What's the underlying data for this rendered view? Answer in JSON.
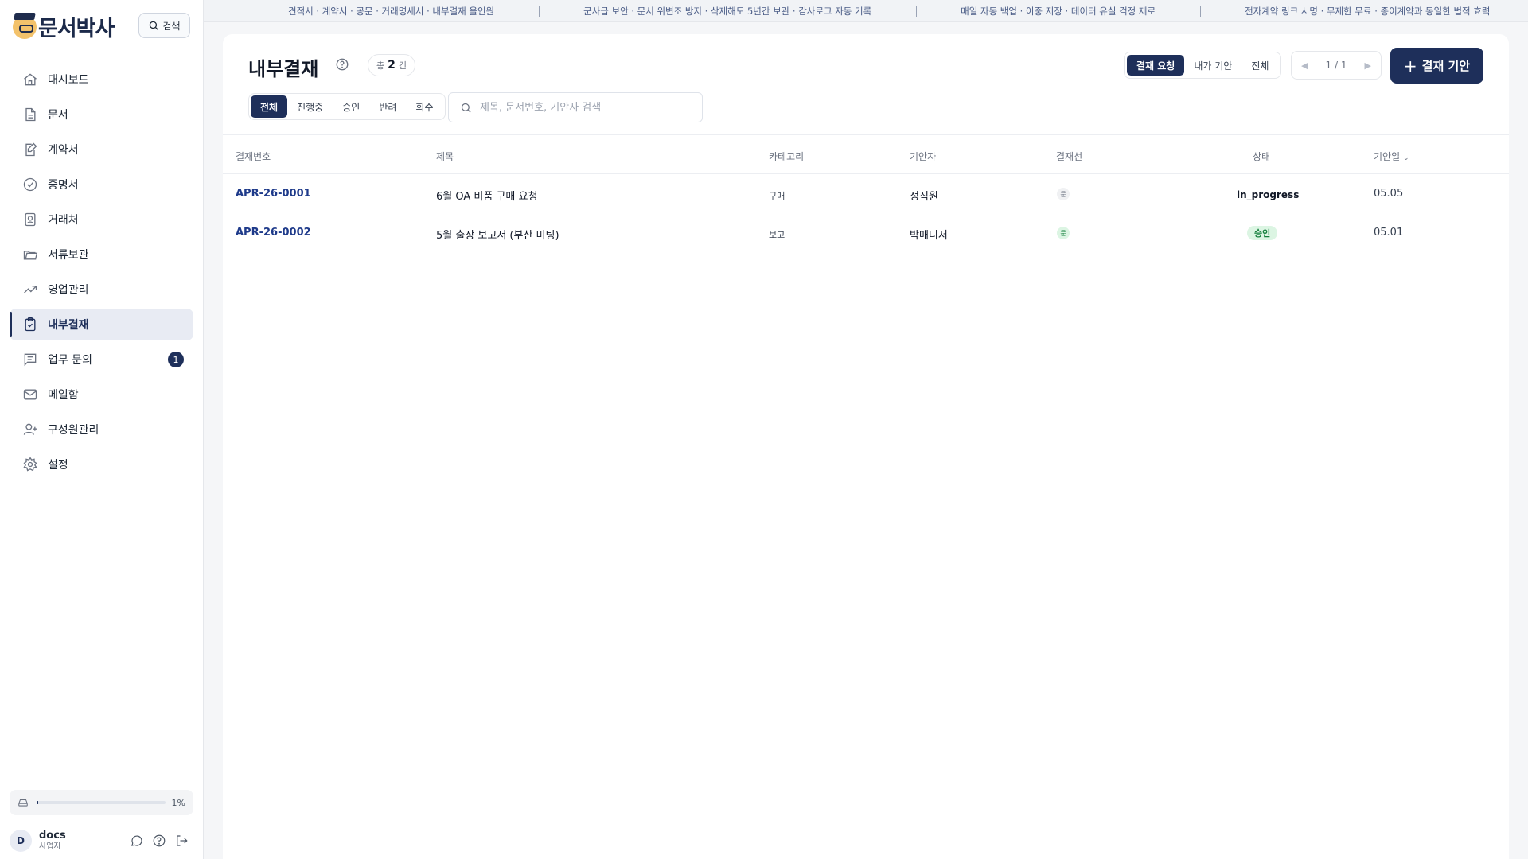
{
  "brand": {
    "name": "문서박사"
  },
  "sidebar": {
    "search_label": "검색",
    "items": [
      {
        "label": "대시보드",
        "icon": "home-icon"
      },
      {
        "label": "문서",
        "icon": "document-icon"
      },
      {
        "label": "계약서",
        "icon": "contract-edit-icon"
      },
      {
        "label": "증명서",
        "icon": "check-circle-icon"
      },
      {
        "label": "거래처",
        "icon": "contact-card-icon"
      },
      {
        "label": "서류보관",
        "icon": "folder-icon"
      },
      {
        "label": "영업관리",
        "icon": "trend-up-icon"
      },
      {
        "label": "내부결재",
        "icon": "clipboard-check-icon",
        "active": true
      },
      {
        "label": "업무 문의",
        "icon": "message-list-icon",
        "badge": "1"
      },
      {
        "label": "메일함",
        "icon": "mail-icon"
      },
      {
        "label": "구성원관리",
        "icon": "user-plus-icon"
      },
      {
        "label": "설정",
        "icon": "gear-icon"
      }
    ],
    "storage": {
      "percent_label": "1%",
      "percent": 1
    },
    "user": {
      "initial": "D",
      "name": "docs",
      "role": "사업자"
    }
  },
  "ticker": [
    "견적서 · 계약서 · 공문 · 거래명세서 · 내부결재 올인원",
    "군사급 보안 · 문서 위변조 방지 · 삭제해도 5년간 보관 · 감사로그 자동 기록",
    "매일 자동 백업 · 이중 저장 · 데이터 유실 걱정 제로",
    "전자계약 링크 서명 · 무제한 무료 · 종이계약과 동일한 법적 효력"
  ],
  "header": {
    "title": "내부결재",
    "count_prefix": "총",
    "count": "2",
    "count_suffix": "건",
    "segments": [
      "결재 요청",
      "내가 기안",
      "전체"
    ],
    "pager": "1 / 1",
    "cta_label": "결재 기안"
  },
  "filters": {
    "tabs": [
      "전체",
      "진행중",
      "승인",
      "반려",
      "회수"
    ],
    "search_placeholder": "제목, 문서번호, 기안자 검색"
  },
  "table": {
    "columns": [
      "결재번호",
      "제목",
      "카테고리",
      "기안자",
      "결재선",
      "상태",
      "기안일"
    ],
    "rows": [
      {
        "id": "APR-26-0001",
        "title": "6월 OA 비품 구매 요청",
        "category": "구매",
        "author": "정직원",
        "approver_mark": "문",
        "approver_state": "pending",
        "status": "in_progress",
        "date": "05.05"
      },
      {
        "id": "APR-26-0002",
        "title": "5월 출장 보고서 (부산 미팅)",
        "category": "보고",
        "author": "박매니저",
        "approver_mark": "문",
        "approver_state": "approved",
        "status": "승인",
        "date": "05.01"
      }
    ]
  },
  "colors": {
    "primary": "#1e2f5a",
    "success_bg": "#dcf5e3",
    "success_text": "#15803d"
  }
}
